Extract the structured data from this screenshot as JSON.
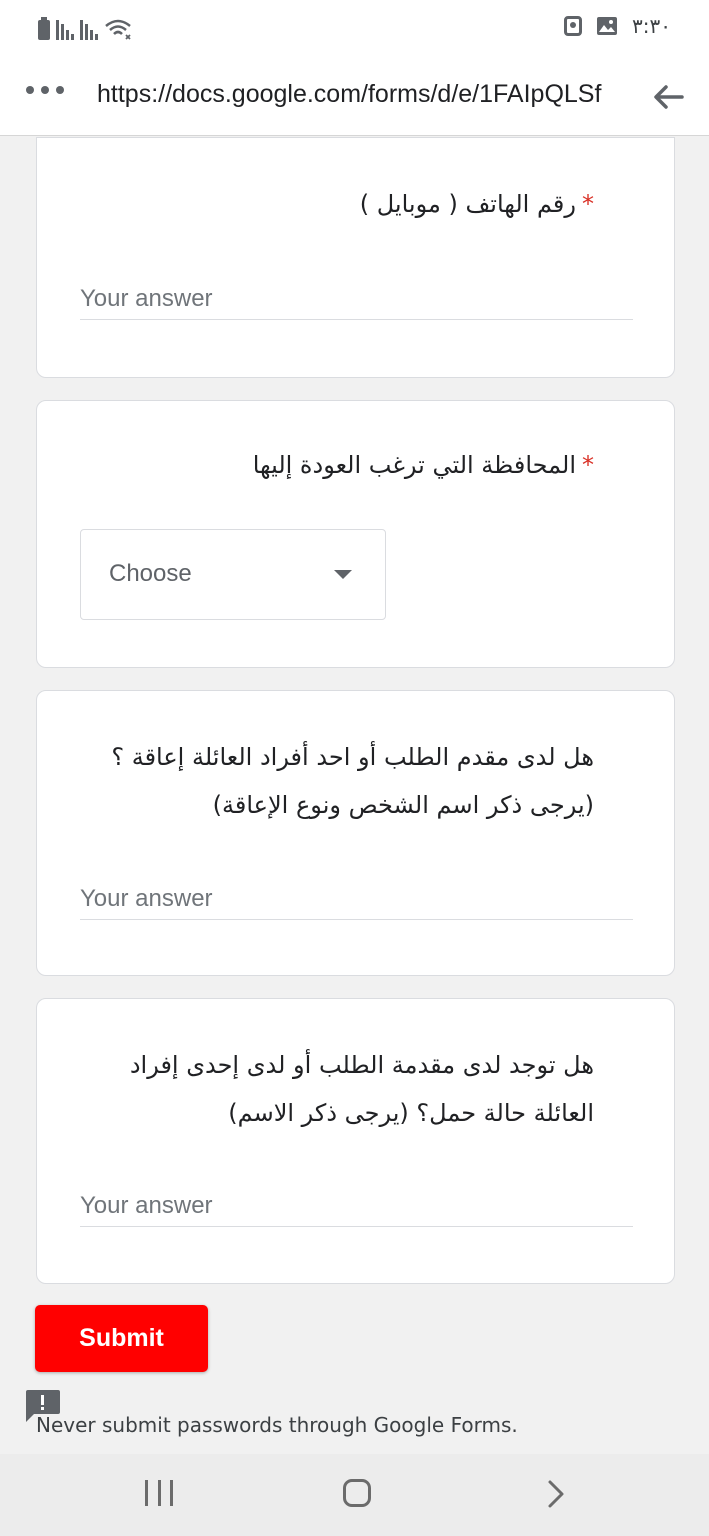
{
  "status_bar": {
    "time": "٣:٣٠",
    "icons": [
      "battery-icon",
      "signal-icon",
      "signal-icon",
      "wifi-icon",
      "alarm-icon",
      "image-icon"
    ]
  },
  "browser": {
    "url": "https://docs.google.com/forms/d/e/1FAIpQLSf",
    "icons": [
      "more-icon",
      "back-arrow-icon"
    ]
  },
  "form": {
    "questions": [
      {
        "title": "رقم الهاتف ( موبايل )",
        "required": "*",
        "placeholder": "Your answer"
      },
      {
        "title": "المحافظة التي ترغب العودة إليها",
        "required": "*",
        "dropdown_value": "Choose"
      },
      {
        "title": "هل لدى مقدم الطلب أو احد أفراد العائلة إعاقة ؟ (يرجى ذكر اسم الشخص ونوع الإعاقة)",
        "placeholder": "Your answer"
      },
      {
        "title": "هل توجد لدى مقدمة الطلب أو لدى إحدى إفراد العائلة حالة حمل؟ (يرجى ذكر الاسم)",
        "placeholder": "Your answer"
      }
    ],
    "submit_label": "Submit",
    "warning_text": "Never submit passwords through Google Forms.",
    "accent_color": "#ff0000",
    "required_color": "#d93025"
  },
  "nav_bar": {
    "icons": [
      "recents-icon",
      "home-icon",
      "back-icon"
    ]
  }
}
